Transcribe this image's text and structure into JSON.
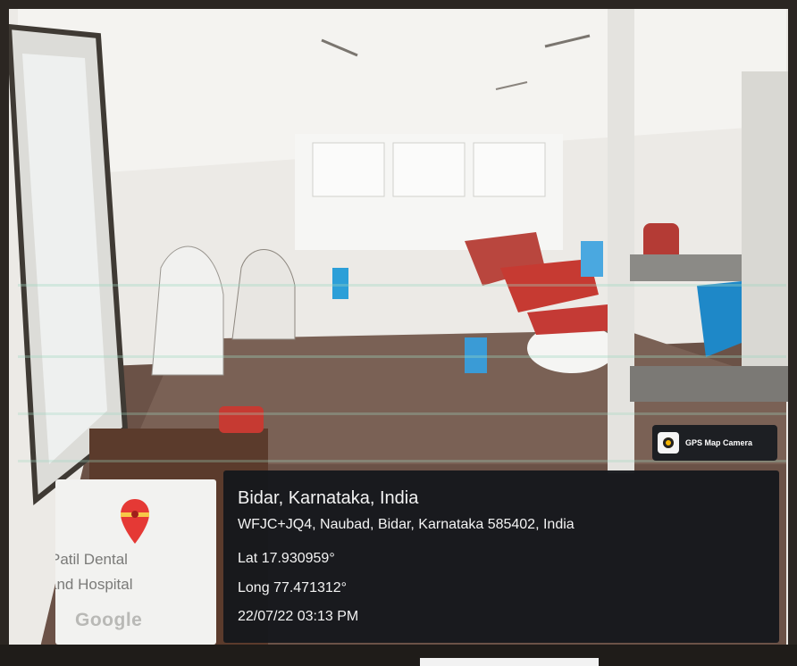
{
  "badge": {
    "icon": "camera-pin-icon",
    "label": "GPS Map Camera"
  },
  "map_thumbnail": {
    "line1": "Patil Dental",
    "line2": "and Hospital",
    "logo_text": "Google",
    "pin_icon": "map-pin-icon",
    "pin_color": "#e53935"
  },
  "location": {
    "place": "Bidar, Karnataka, India",
    "address": "WFJC+JQ4, Naubad, Bidar, Karnataka 585402, India",
    "latitude": "Lat 17.930959°",
    "longitude": "Long 77.471312°",
    "timestamp": "22/07/22 03:13 PM"
  },
  "colors": {
    "panel_bg": "#16181c",
    "floor": "#6b5247",
    "chair_red": "#c63a32",
    "blue_cloth": "#1e88c8"
  }
}
